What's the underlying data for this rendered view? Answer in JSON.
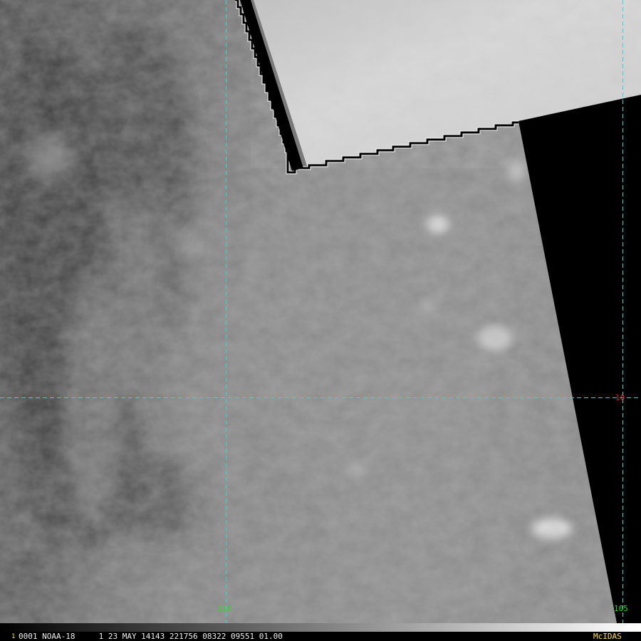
{
  "image": {
    "satellite": "NOAA-18",
    "status_line": {
      "frame_number": "1",
      "info_text": "0001 NOAA-18     1 23 MAY 14143 221756 08322 09551 01.00",
      "brand": "McIDAS"
    },
    "grid_labels": {
      "lon_110": "110",
      "lon_105": "105",
      "lat_10": "10"
    }
  },
  "colors": {
    "grid_line": "#33d6d6",
    "lon_label": "#2ed82e",
    "lat_label": "#d62828",
    "status_text": "#f0f0f0",
    "frame_number": "#ffe14d",
    "brand": "#ffe14d",
    "no_data": "#000000",
    "cloud_bright": "#d6d6d6",
    "cloud_mid": "#8a8a8a",
    "cloud_dark": "#555555"
  }
}
